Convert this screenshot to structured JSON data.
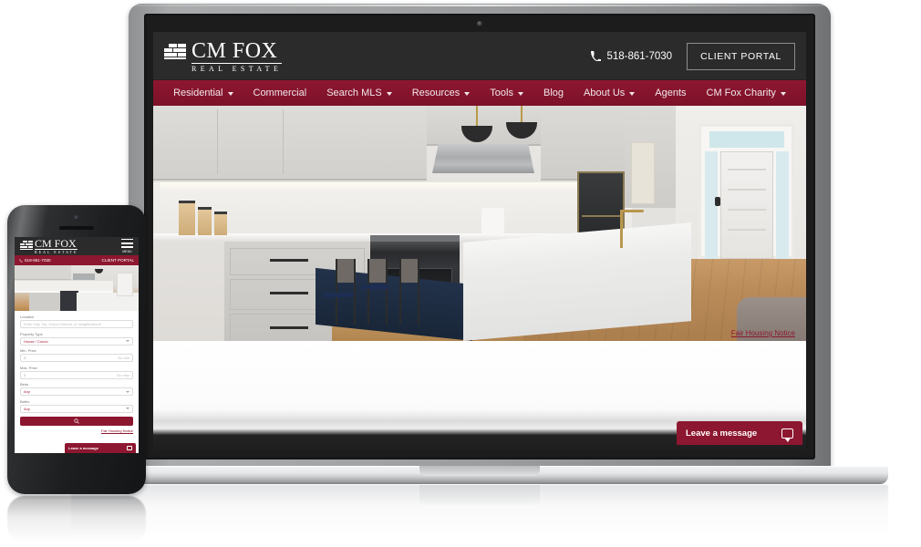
{
  "brand": {
    "name": "CM FOX",
    "tagline": "REAL ESTATE",
    "mark": "brick-stack-logo-icon"
  },
  "header": {
    "phone": "518-861-7030",
    "phone_icon": "phone-icon",
    "client_portal_label": "CLIENT PORTAL"
  },
  "nav": {
    "items": [
      {
        "label": "Residential",
        "caret": true
      },
      {
        "label": "Commercial",
        "caret": false
      },
      {
        "label": "Search MLS",
        "caret": true
      },
      {
        "label": "Resources",
        "caret": true
      },
      {
        "label": "Tools",
        "caret": true
      },
      {
        "label": "Blog",
        "caret": false
      },
      {
        "label": "About Us",
        "caret": true
      },
      {
        "label": "Agents",
        "caret": false
      },
      {
        "label": "CM Fox Charity",
        "caret": true
      }
    ]
  },
  "hero": {
    "alt": "modern white kitchen with island, bar stools, pendant lights and entry foyer"
  },
  "search": {
    "location_label": "Location",
    "location_placeholder": "Enter City, Zip, School District, or Neighborhood",
    "property_type_label": "Property Type",
    "property_type_value": "House / Condo",
    "min_price_label": "Min. Price",
    "min_price_prefix": "$",
    "min_price_placeholder": "No min",
    "max_price_label": "Max. Price",
    "max_price_prefix": "$",
    "max_price_placeholder": "No max",
    "beds_label": "Beds",
    "beds_value": "Any",
    "baths_label": "Baths",
    "baths_value": "Any",
    "search_icon": "magnifier-icon"
  },
  "links": {
    "fair_housing": "Fair Housing Notice"
  },
  "chat": {
    "label": "Leave a message",
    "icon": "chat-bubble-icon"
  },
  "mobile": {
    "menu_label": "MENU",
    "phone": "518-861-7030",
    "client_portal_label": "CLIENT PORTAL",
    "search": {
      "location_label": "Location",
      "location_placeholder": "Enter City, Zip, School District, or Neighborhood",
      "property_type_label": "Property Type",
      "property_type_value": "House / Condo",
      "min_price_label": "Min. Price",
      "min_price_prefix": "$",
      "min_price_placeholder": "No min",
      "max_price_label": "Max. Price",
      "max_price_prefix": "$",
      "max_price_placeholder": "No max",
      "beds_label": "Beds",
      "beds_value": "Any",
      "baths_label": "Baths",
      "baths_value": "Any"
    },
    "fair_housing": "Fair Housing Notice",
    "chat_label": "Leave a message"
  },
  "colors": {
    "brand_crimson": "#8d1730",
    "header_dark": "#2b2b2b",
    "accent_red_text": "#a21f3d"
  }
}
